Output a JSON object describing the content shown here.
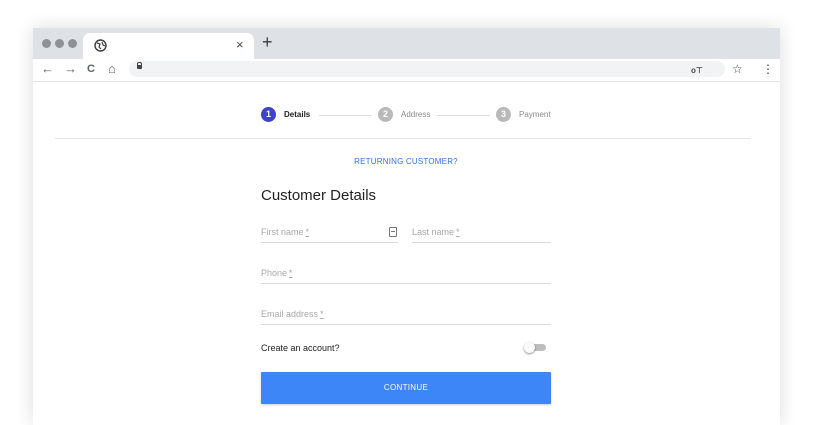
{
  "browser": {
    "tab_close": "×",
    "new_tab": "+",
    "nav": {
      "back": "←",
      "forward": "→",
      "reload": "C",
      "home": "⌂"
    },
    "tools": {
      "key": "o⊤",
      "star": "☆",
      "menu": "⋮"
    }
  },
  "stepper": {
    "steps": [
      {
        "number": "1",
        "label": "Details",
        "active": true
      },
      {
        "number": "2",
        "label": "Address",
        "active": false
      },
      {
        "number": "3",
        "label": "Payment",
        "active": false
      }
    ],
    "active_color": "#3f43c6",
    "inactive_color": "#b9b9b9"
  },
  "form": {
    "returning_link": "RETURNING CUSTOMER?",
    "title": "Customer Details",
    "fields": {
      "first_name": "First name",
      "last_name": "Last name",
      "phone": "Phone",
      "email": "Email address",
      "required_marker": "*"
    },
    "create_account": "Create an account?",
    "create_account_enabled": false,
    "continue_label": "CONTINUE"
  },
  "colors": {
    "primary_button": "#3d86f7",
    "link": "#2e73e8"
  }
}
